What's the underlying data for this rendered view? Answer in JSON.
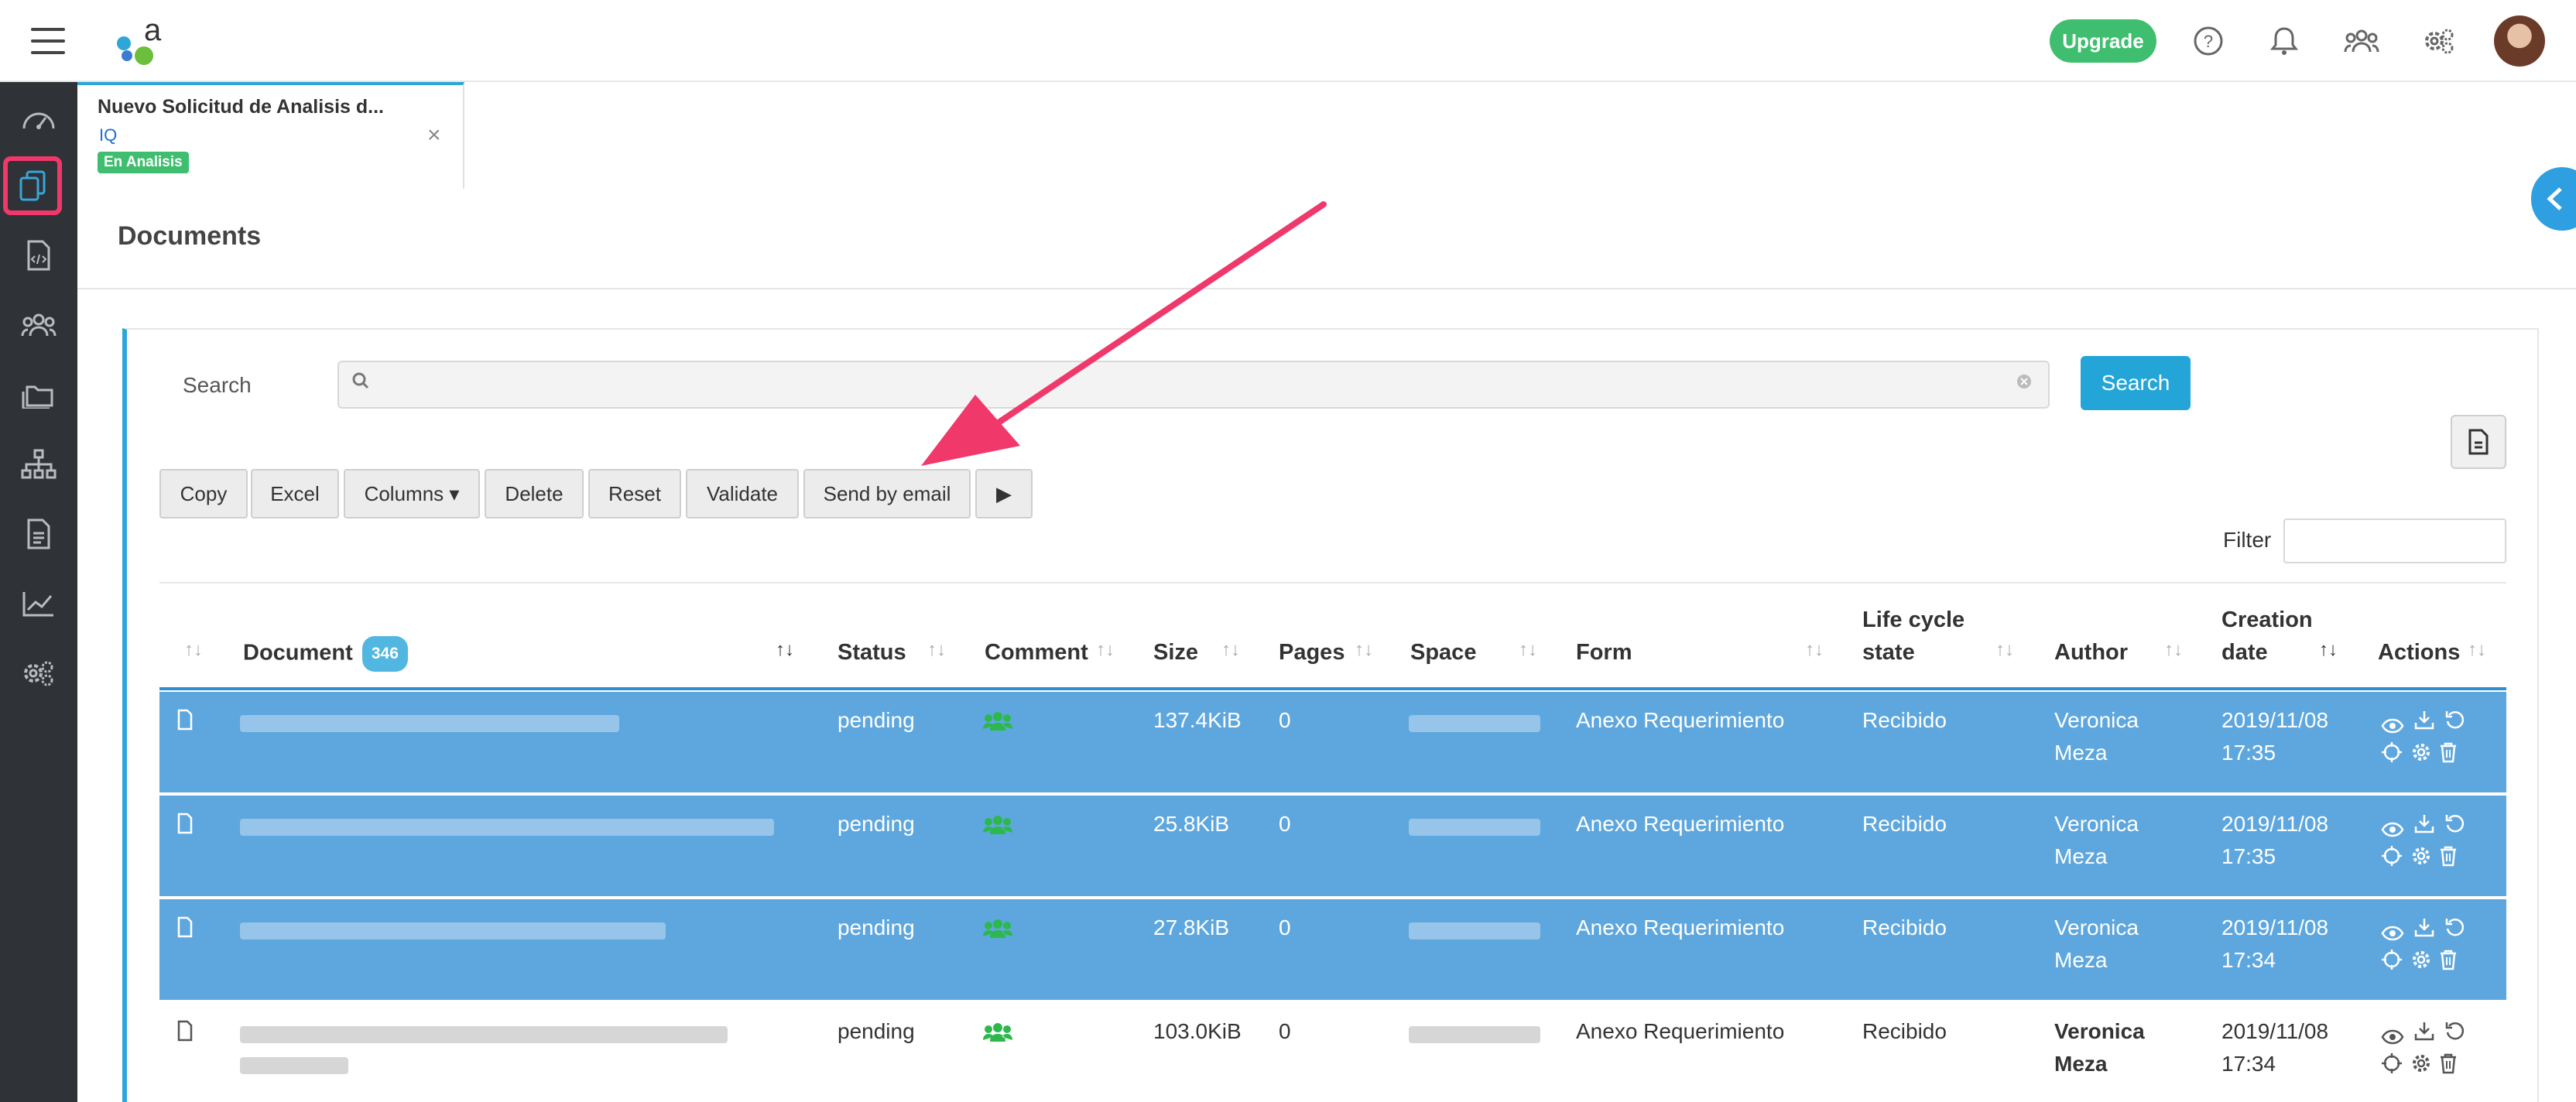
{
  "header": {
    "upgrade_label": "Upgrade",
    "icons": [
      "help-icon",
      "bell-icon",
      "users-icon",
      "settings-icon"
    ]
  },
  "sidebar": {
    "items": [
      "dashboard-icon",
      "documents-icon",
      "code-file-icon",
      "users-icon",
      "folders-icon",
      "org-chart-icon",
      "report-icon",
      "chart-icon",
      "settings-icon"
    ],
    "active": "documents-icon"
  },
  "tab": {
    "title": "Nuevo Solicitud de Analisis d...",
    "subtitle": "IQ",
    "badge": "En Analisis",
    "close": "×"
  },
  "page": {
    "title": "Documents"
  },
  "search": {
    "label": "Search",
    "button": "Search",
    "value": ""
  },
  "toolbar": {
    "buttons": [
      "Copy",
      "Excel",
      "Columns ▾",
      "Delete",
      "Reset",
      "Validate",
      "Send by email",
      "▶"
    ]
  },
  "filter": {
    "label": "Filter",
    "value": ""
  },
  "table": {
    "headers": {
      "document": "Document",
      "document_count": "346",
      "status": "Status",
      "comment": "Comment",
      "size": "Size",
      "pages": "Pages",
      "space": "Space",
      "form": "Form",
      "lifecycle": "Life cycle state",
      "author": "Author",
      "creation": "Creation date",
      "actions": "Actions"
    },
    "rows": [
      {
        "status": "pending",
        "size": "137.4KiB",
        "pages": "0",
        "form": "Anexo Requerimiento",
        "lifecycle": "Recibido",
        "author_1": "Veronica",
        "author_2": "Meza",
        "date_1": "2019/11/08",
        "date_2": "17:35",
        "selected": true
      },
      {
        "status": "pending",
        "size": "25.8KiB",
        "pages": "0",
        "form": "Anexo Requerimiento",
        "lifecycle": "Recibido",
        "author_1": "Veronica",
        "author_2": "Meza",
        "date_1": "2019/11/08",
        "date_2": "17:35",
        "selected": true
      },
      {
        "status": "pending",
        "size": "27.8KiB",
        "pages": "0",
        "form": "Anexo Requerimiento",
        "lifecycle": "Recibido",
        "author_1": "Veronica",
        "author_2": "Meza",
        "date_1": "2019/11/08",
        "date_2": "17:34",
        "selected": true
      },
      {
        "status": "pending",
        "size": "103.0KiB",
        "pages": "0",
        "form": "Anexo Requerimiento",
        "lifecycle": "Recibido",
        "author_1": "Veronica",
        "author_2": "Meza",
        "date_1": "2019/11/08",
        "date_2": "17:34",
        "selected": false
      }
    ]
  },
  "colors": {
    "accent": "#23a5d8",
    "selected_row": "#5ea7de",
    "success": "#3ebe6e",
    "highlight": "#f0386b",
    "sidebar": "#2f3337"
  }
}
